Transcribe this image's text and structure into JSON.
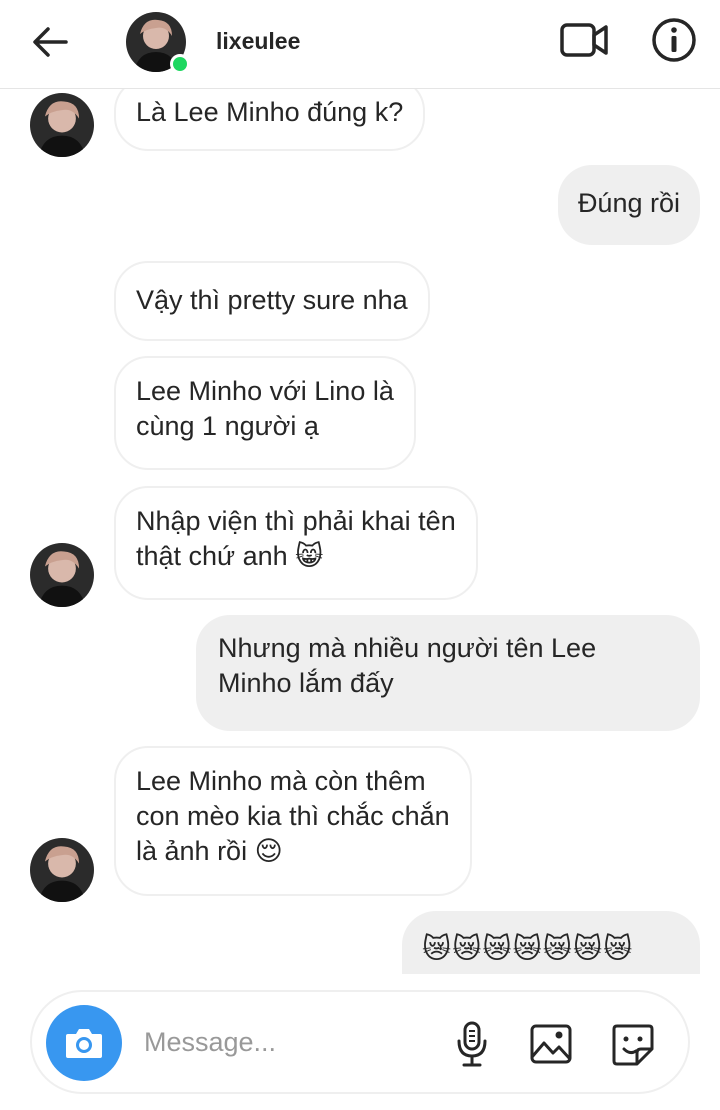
{
  "header": {
    "username": "lixeulee",
    "back_icon": "arrow-left-icon",
    "video_icon": "video-camera-icon",
    "info_icon": "info-icon",
    "online_color": "#1ed760"
  },
  "messages": [
    {
      "side": "in",
      "text": "Là Lee Minho đúng k?",
      "avatar": true
    },
    {
      "side": "out",
      "text": "Đúng rồi"
    },
    {
      "side": "in",
      "text": "Vậy thì pretty sure nha"
    },
    {
      "side": "in",
      "lines": [
        "Lee Minho với Lino là",
        "cùng 1 người ạ"
      ]
    },
    {
      "side": "in",
      "lines": [
        "Nhập viện thì phải khai tên",
        "thật chứ anh 😸"
      ],
      "avatar": true
    },
    {
      "side": "out",
      "lines": [
        "Nhưng mà nhiều người tên Lee",
        "Minho lắm đấy"
      ]
    },
    {
      "side": "in",
      "lines": [
        "Lee Minho mà còn thêm",
        "con mèo kia thì chắc chắn",
        "là ảnh rồi 😌"
      ],
      "avatar": true
    },
    {
      "side": "out",
      "text": "😿😿😿😿😿😿😿"
    }
  ],
  "composer": {
    "placeholder": "Message...",
    "camera_icon": "camera-icon",
    "mic_icon": "microphone-icon",
    "gallery_icon": "image-gallery-icon",
    "sticker_icon": "sticker-icon",
    "accent": "#3897f0"
  }
}
